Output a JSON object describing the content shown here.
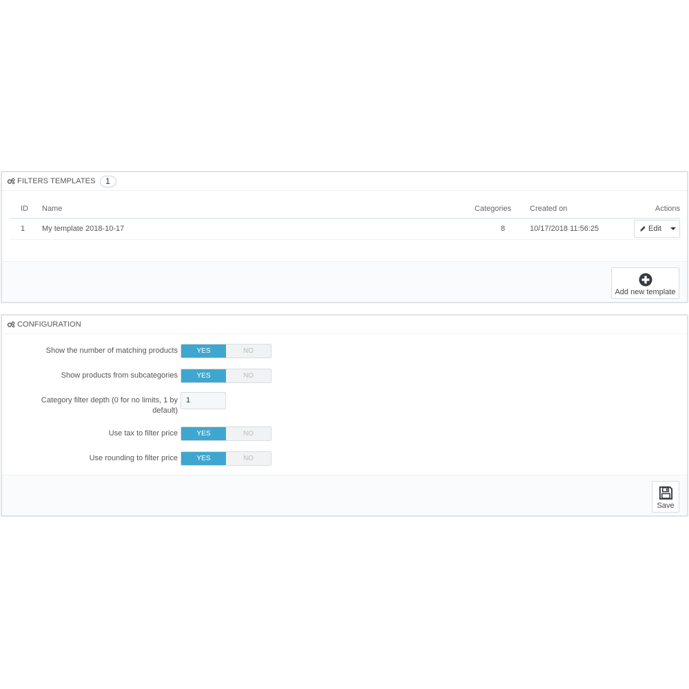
{
  "templates_panel": {
    "title": "FILTERS TEMPLATES",
    "count": "1",
    "columns": {
      "id": "ID",
      "name": "Name",
      "categories": "Categories",
      "created_on": "Created on",
      "actions": "Actions"
    },
    "rows": [
      {
        "id": "1",
        "name": "My template 2018-10-17",
        "categories": "8",
        "created_on": "10/17/2018 11:56:25",
        "edit_label": "Edit"
      }
    ],
    "add_button_label": "Add new template"
  },
  "config_panel": {
    "title": "CONFIGURATION",
    "fields": [
      {
        "label": "Show the number of matching products",
        "yes": "YES",
        "no": "NO",
        "value": "YES"
      },
      {
        "label": "Show products from subcategories",
        "yes": "YES",
        "no": "NO",
        "value": "YES"
      },
      {
        "label": "Category filter depth (0 for no limits, 1 by default)",
        "value": "1"
      },
      {
        "label": "Use tax to filter price",
        "yes": "YES",
        "no": "NO",
        "value": "YES"
      },
      {
        "label": "Use rounding to filter price",
        "yes": "YES",
        "no": "NO",
        "value": "YES"
      }
    ],
    "save_label": "Save"
  },
  "icons": {
    "heading": "gears-icon",
    "edit": "pencil-icon",
    "add": "plus-circle-icon",
    "save": "floppy-disk-icon"
  },
  "colors": {
    "switch_on": "#3fa7cf",
    "border": "#dfe3e6"
  }
}
